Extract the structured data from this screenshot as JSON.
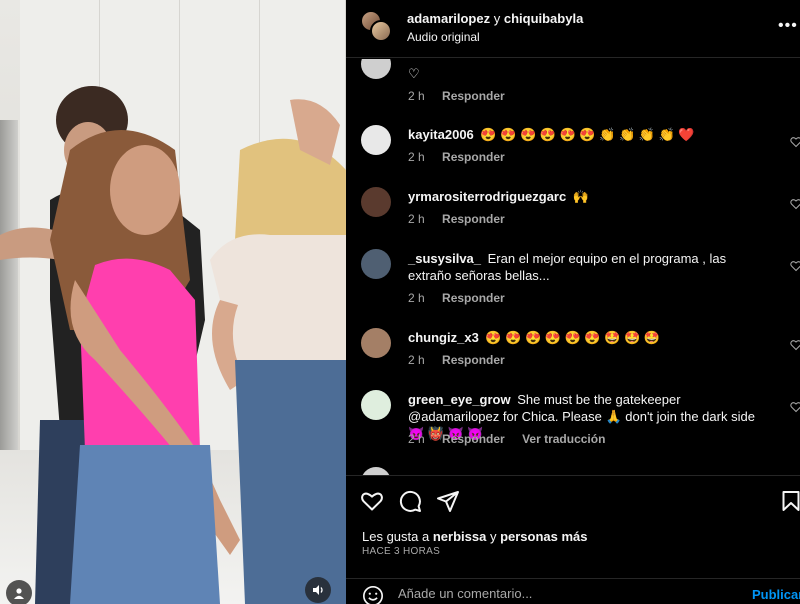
{
  "header": {
    "user1": "adamarilopez",
    "separator": "y",
    "user2": "chiquibabyla",
    "audio": "Audio original",
    "more_icon": "more-horizontal-icon"
  },
  "comments": [
    {
      "username": "",
      "text": "♡",
      "time": "2 h",
      "reply": "Responder",
      "avatar_color": "#cfcfcf"
    },
    {
      "username": "kayita2006",
      "text": "😍 😍 😍 😍 😍 😍 👏 👏 👏 👏 ❤️",
      "time": "2 h",
      "reply": "Responder",
      "avatar_color": "#e8e8e8"
    },
    {
      "username": "yrmarositerrodriguezgarc",
      "text": "🙌",
      "time": "2 h",
      "reply": "Responder",
      "avatar_color": "#5a3a2e"
    },
    {
      "username": "_susysilva_",
      "text": "Eran el mejor equipo en el programa , las extraño señoras bellas...",
      "time": "2 h",
      "reply": "Responder",
      "avatar_color": "#4f5f72"
    },
    {
      "username": "chungiz_x3",
      "text": "😍 😍 😍 😍 😍 😍 🤩 🤩 🤩",
      "time": "2 h",
      "reply": "Responder",
      "avatar_color": "#a47f66"
    },
    {
      "username": "green_eye_grow",
      "text": "She must be the gatekeeper @adamarilopez for Chica. Please 🙏 don't join the dark side 😈 👹 👿 👿",
      "time": "2 h",
      "reply": "Responder",
      "translate": "Ver traducción",
      "avatar_color": "#dfeede"
    }
  ],
  "actions": {
    "like_icon": "heart-icon",
    "comment_icon": "comment-icon",
    "share_icon": "send-icon",
    "save_icon": "bookmark-icon",
    "likes_prefix": "Les gusta a",
    "likes_user": "nerbissa",
    "likes_and": "y",
    "likes_rest": "personas más",
    "time": "HACE 3 HORAS"
  },
  "comment_box": {
    "placeholder": "Añade un comentario...",
    "publish": "Publicar",
    "emoji_icon": "smile-icon"
  },
  "colors": {
    "background": "#000000",
    "text": "#f5f5f5",
    "secondary": "#a8a8a8",
    "link": "#0095f6",
    "pink_top": "#ff3fae"
  }
}
